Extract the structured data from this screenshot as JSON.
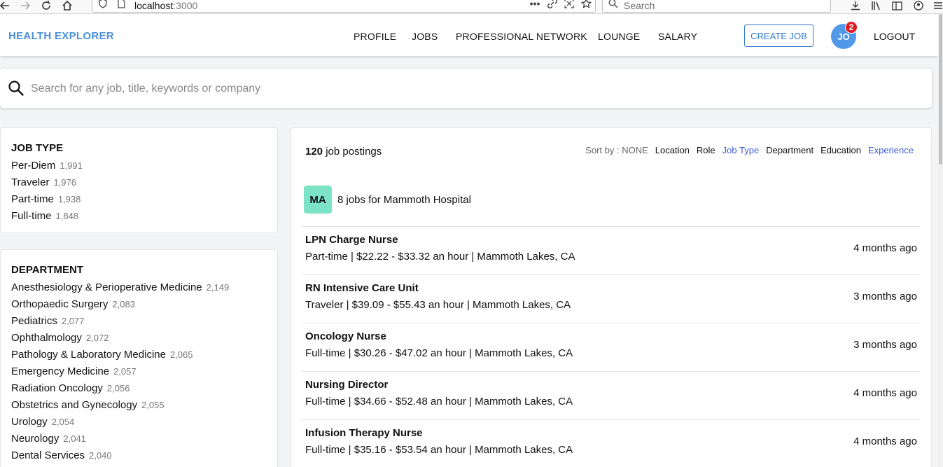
{
  "browser": {
    "url_host": "localhost",
    "url_port": ":3000",
    "search_placeholder": "Search"
  },
  "header": {
    "brand": "HEALTH EXPLORER",
    "nav": [
      "PROFILE",
      "JOBS",
      "PROFESSIONAL NETWORK",
      "LOUNGE",
      "SALARY"
    ],
    "create_job": "CREATE JOB",
    "avatar_initials": "JO",
    "notification_count": "2",
    "logout": "LOGOUT"
  },
  "search": {
    "placeholder": "Search for any job, title, keywords or company"
  },
  "filters": {
    "job_type": {
      "title": "JOB TYPE",
      "items": [
        {
          "label": "Per-Diem",
          "count": "1,991"
        },
        {
          "label": "Traveler",
          "count": "1,976"
        },
        {
          "label": "Part-time",
          "count": "1,938"
        },
        {
          "label": "Full-time",
          "count": "1,848"
        }
      ]
    },
    "department": {
      "title": "DEPARTMENT",
      "items": [
        {
          "label": "Anesthesiology & Perioperative Medicine",
          "count": "2,149"
        },
        {
          "label": "Orthopaedic Surgery",
          "count": "2,083"
        },
        {
          "label": "Pediatrics",
          "count": "2,077"
        },
        {
          "label": "Ophthalmology",
          "count": "2,072"
        },
        {
          "label": "Pathology & Laboratory Medicine",
          "count": "2,065"
        },
        {
          "label": "Emergency Medicine",
          "count": "2,057"
        },
        {
          "label": "Radiation Oncology",
          "count": "2,056"
        },
        {
          "label": "Obstetrics and Gynecology",
          "count": "2,055"
        },
        {
          "label": "Urology",
          "count": "2,054"
        },
        {
          "label": "Neurology",
          "count": "2,041"
        },
        {
          "label": "Dental Services",
          "count": "2,040"
        }
      ]
    }
  },
  "results": {
    "count": "120",
    "count_suffix": "job postings",
    "sort_label": "Sort by : NONE",
    "sort_options": [
      {
        "label": "Location",
        "active": false
      },
      {
        "label": "Role",
        "active": false
      },
      {
        "label": "Job Type",
        "active": true
      },
      {
        "label": "Department",
        "active": false
      },
      {
        "label": "Education",
        "active": false
      },
      {
        "label": "Experience",
        "active": true
      }
    ],
    "company": {
      "initials": "MA",
      "label": "8 jobs for Mammoth Hospital"
    },
    "jobs": [
      {
        "title": "LPN Charge Nurse",
        "meta": "Part-time | $22.22 - $33.32 an hour | Mammoth Lakes, CA",
        "age": "4 months ago"
      },
      {
        "title": "RN Intensive Care Unit",
        "meta": "Traveler | $39.09 - $55.43 an hour | Mammoth Lakes, CA",
        "age": "3 months ago"
      },
      {
        "title": "Oncology Nurse",
        "meta": "Full-time | $30.26 - $47.02 an hour | Mammoth Lakes, CA",
        "age": "3 months ago"
      },
      {
        "title": "Nursing Director",
        "meta": "Full-time | $34.66 - $52.48 an hour | Mammoth Lakes, CA",
        "age": "4 months ago"
      },
      {
        "title": "Infusion Therapy Nurse",
        "meta": "Full-time | $35.16 - $53.54 an hour | Mammoth Lakes, CA",
        "age": "4 months ago"
      }
    ]
  }
}
